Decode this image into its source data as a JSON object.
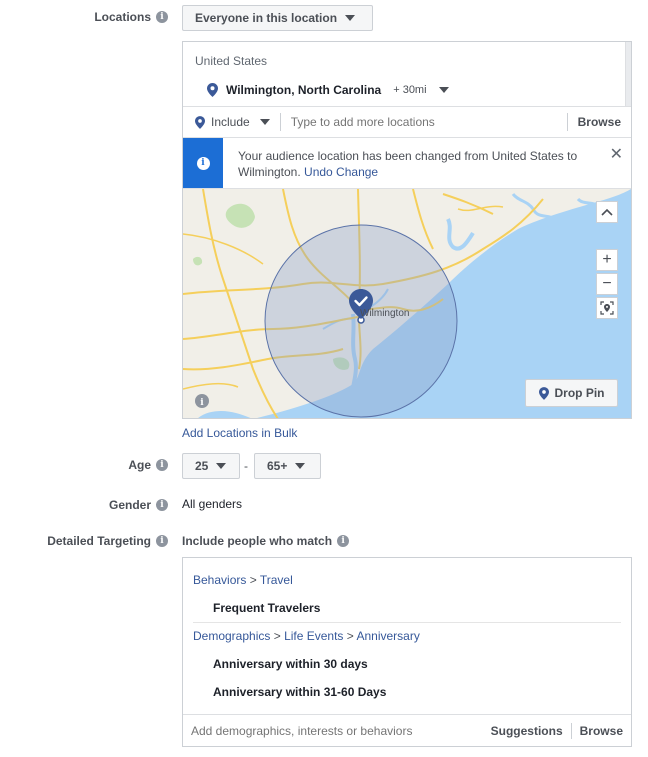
{
  "locations": {
    "label": "Locations",
    "mode_dropdown": "Everyone in this location",
    "country": "United States",
    "city": "Wilmington, North Carolina",
    "radius": "+ 30mi",
    "include_label": "Include",
    "search_placeholder": "Type to add more locations",
    "browse_label": "Browse",
    "notice_text": "Your audience location has been changed from United States to Wilmington.",
    "notice_undo": "Undo Change",
    "map_city_label": "Wilmington",
    "drop_pin_label": "Drop Pin",
    "zoom_in": "+",
    "zoom_out": "−",
    "add_bulk_link": "Add Locations in Bulk"
  },
  "age": {
    "label": "Age",
    "min": "25",
    "separator": "-",
    "max": "65+"
  },
  "gender": {
    "label": "Gender",
    "value": "All genders"
  },
  "detailed_targeting": {
    "label": "Detailed Targeting",
    "include_text": "Include people who match",
    "groups": [
      {
        "path": [
          "Behaviors",
          "Travel"
        ],
        "items": [
          "Frequent Travelers"
        ]
      },
      {
        "path": [
          "Demographics",
          "Life Events",
          "Anniversary"
        ],
        "items": [
          "Anniversary within 30 days",
          "Anniversary within 31-60 Days"
        ]
      }
    ],
    "path_separator": ">",
    "search_placeholder": "Add demographics, interests or behaviors",
    "suggestions_label": "Suggestions",
    "browse_label": "Browse"
  },
  "icons": {
    "info": "i",
    "close": "✕"
  },
  "colors": {
    "accent_blue": "#1c6ed5",
    "link_blue": "#365899",
    "pin_blue": "#3b5998",
    "water": "#a9d3f5",
    "radius_fill": "#8aa0c8"
  }
}
